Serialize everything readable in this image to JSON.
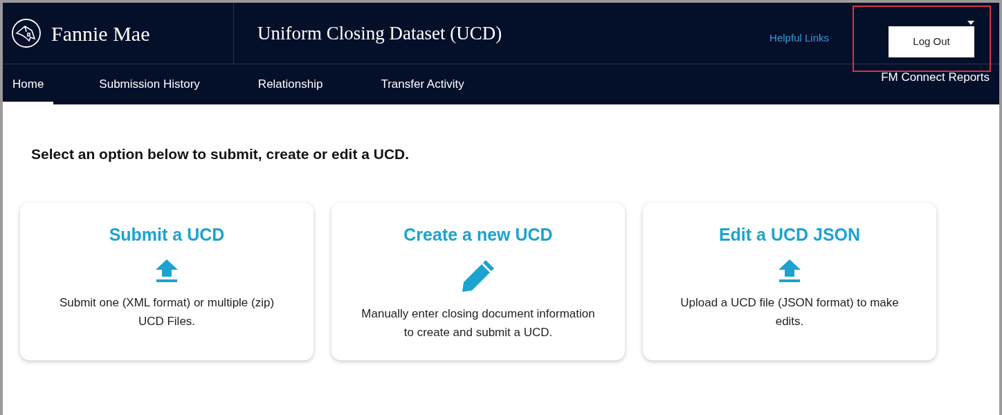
{
  "brand": {
    "name": "Fannie Mae",
    "app_title": "Uniform Closing Dataset (UCD)"
  },
  "header_links": [
    {
      "label": "Helpful Links"
    }
  ],
  "user_menu": {
    "expanded": true,
    "highlighted": true,
    "items": [
      {
        "label": "Log Out"
      }
    ]
  },
  "nav": [
    {
      "label": "Home",
      "selected": true
    },
    {
      "label": "Submission History",
      "selected": false
    },
    {
      "label": "Relationship",
      "selected": false
    },
    {
      "label": "Transfer Activity",
      "selected": false
    },
    {
      "label": "FM Connect Reports",
      "selected": false
    }
  ],
  "heading": "Select an option below to submit, create or edit a UCD.",
  "options": [
    {
      "title": "Submit a UCD",
      "kind": "upload",
      "description": "Submit one (XML format) or multiple (zip) UCD Files."
    },
    {
      "title": "Create a new UCD",
      "kind": "edit",
      "description": "Manually enter closing document information to create and submit a UCD."
    },
    {
      "title": "Edit a UCD JSON",
      "kind": "upload",
      "description": "Upload a UCD file (JSON format) to make edits."
    }
  ]
}
